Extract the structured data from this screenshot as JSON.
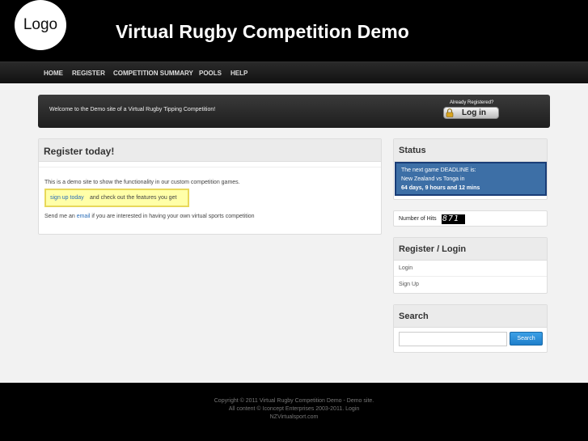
{
  "header": {
    "logo": "Logo",
    "title": "Virtual Rugby Competition Demo"
  },
  "nav": {
    "items": [
      "HOME",
      "REGISTER",
      "COMPETITION SUMMARY",
      "POOLS",
      "HELP"
    ]
  },
  "welcome": {
    "text": "Welcome to the Demo site of a Virtual Rugby Tipping Competition!",
    "already": "Already Registered?",
    "login": "Log in"
  },
  "main": {
    "heading": "Register today!",
    "intro": "This is a demo site to show the functionality in our custom competition games.",
    "signup_link": "sign up today",
    "signup_rest": "and check out the features you get",
    "send_pre": "Send me an",
    "email_link": "email",
    "send_post": "if you are interested in having your own virtual sports competition"
  },
  "status": {
    "heading": "Status",
    "line1": "The next game DEADLINE is:",
    "line2": "New Zealand vs Tonga in",
    "line3": "64 days, 9 hours and 12 mins"
  },
  "hits": {
    "label": "Number of Hits",
    "value": "871"
  },
  "register_login": {
    "heading": "Register / Login",
    "items": [
      "Login",
      "Sign Up"
    ]
  },
  "search": {
    "heading": "Search",
    "button": "Search",
    "value": ""
  },
  "footer": {
    "line1": "Copyright © 2011 Virtual Rugby Competition Demo - Demo site.",
    "line2": "All content © Iconcept Enterprises 2003-2011. Login",
    "line3": "NZVirtualsport.com"
  }
}
